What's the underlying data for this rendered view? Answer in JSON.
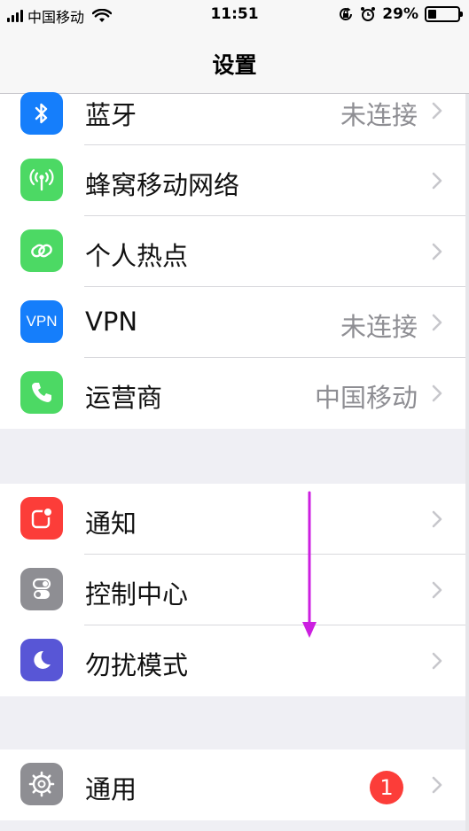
{
  "status_bar": {
    "carrier": "中国移动",
    "time": "11:51",
    "battery_percent": "29%",
    "battery_level": 0.29,
    "signal_bars": 4,
    "icons": [
      "signal-icon",
      "wifi-icon",
      "orientation-lock-icon",
      "alarm-icon",
      "battery-icon"
    ]
  },
  "nav": {
    "title": "设置"
  },
  "groups": [
    {
      "rows": [
        {
          "label": "蓝牙",
          "detail": "未连接",
          "icon": "bluetooth-icon",
          "icon_color": "#157efb"
        },
        {
          "label": "蜂窝移动网络",
          "detail": "",
          "icon": "cellular-antenna-icon",
          "icon_color": "#4cd964"
        },
        {
          "label": "个人热点",
          "detail": "",
          "icon": "personal-hotspot-icon",
          "icon_color": "#4cd964"
        },
        {
          "label": "VPN",
          "detail": "未连接",
          "icon": "vpn-icon",
          "icon_text": "VPN",
          "icon_color": "#157efb"
        },
        {
          "label": "运营商",
          "detail": "中国移动",
          "icon": "phone-icon",
          "icon_color": "#4cd964"
        }
      ]
    },
    {
      "rows": [
        {
          "label": "通知",
          "detail": "",
          "icon": "notifications-icon",
          "icon_color": "#fc3d39"
        },
        {
          "label": "控制中心",
          "detail": "",
          "icon": "control-center-icon",
          "icon_color": "#8e8e93"
        },
        {
          "label": "勿扰模式",
          "detail": "",
          "icon": "moon-icon",
          "icon_color": "#5856d6"
        }
      ]
    },
    {
      "rows": [
        {
          "label": "通用",
          "detail": "",
          "badge": "1",
          "icon": "gear-icon",
          "icon_color": "#8e8e93"
        }
      ]
    }
  ],
  "annotation": {
    "arrow_color": "#cc1fe0",
    "direction": "down"
  },
  "chevron_color": "#c7c7cc"
}
